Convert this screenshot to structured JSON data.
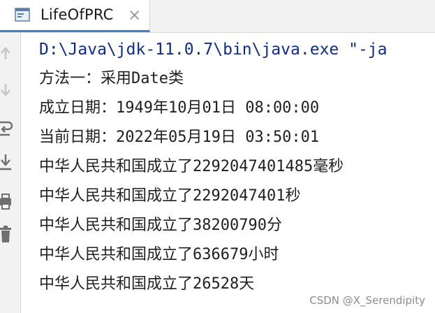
{
  "tab": {
    "title": "LifeOfPRC",
    "close_glyph": "×"
  },
  "toolbar": {
    "icons": [
      "arrow-up-icon",
      "arrow-down-icon",
      "soft-wrap-icon",
      "scroll-to-end-icon",
      "print-icon",
      "trash-icon"
    ]
  },
  "console": {
    "command": "D:\\Java\\jdk-11.0.7\\bin\\java.exe \"-ja",
    "lines": [
      "方法一：采用Date类",
      "成立日期：1949年10月01日 08:00:00",
      "当前日期：2022年05月19日 03:50:01",
      "中华人民共和国成立了2292047401485毫秒",
      "中华人民共和国成立了2292047401秒",
      "中华人民共和国成立了38200790分",
      "中华人民共和国成立了636679小时",
      "中华人民共和国成立了26528天"
    ]
  },
  "watermark": "CSDN @X_Serendipity",
  "colors": {
    "command_text": "#0b2e8c",
    "tab_underline": "#4083c9",
    "toolbar_bg": "#f2f2f2"
  }
}
